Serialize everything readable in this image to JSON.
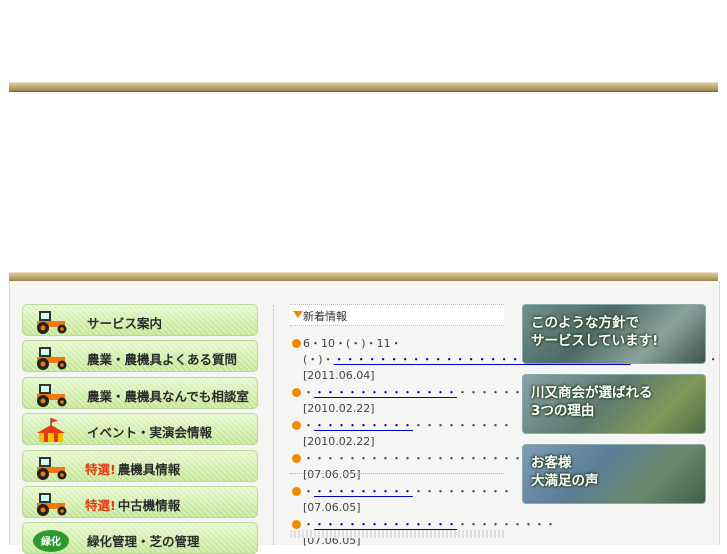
{
  "nav": {
    "items": [
      {
        "label": "サービス案内",
        "prefix": "",
        "icon": "tractor-icon"
      },
      {
        "label": "農業・農機具よくある質問",
        "prefix": "",
        "icon": "tractor-icon"
      },
      {
        "label": "農業・農機具なんでも相談室",
        "prefix": "",
        "icon": "tractor-icon"
      },
      {
        "label": "イベント・実演会情報",
        "prefix": "",
        "icon": "tent-icon"
      },
      {
        "label": "農機具情報",
        "prefix": "特選!",
        "icon": "tractor-icon"
      },
      {
        "label": "中古機情報",
        "prefix": "特選!",
        "icon": "tractor-icon"
      },
      {
        "label": "緑化管理・芝の管理",
        "prefix": "",
        "icon": "greening-badge-icon",
        "badge_text": "緑化"
      }
    ]
  },
  "news": {
    "title": "新着情報",
    "items": [
      {
        "pre": "6・10・(・)・11・(・)・",
        "link": "・・・・・・・・・・・・・・・・・・・・・・・・・・・",
        "post": "・・・・・・・・",
        "date": "[2011.06.04]"
      },
      {
        "pre": "・",
        "link": "・・・・・・・・・・・・・",
        "post": "・・・・・・・・・",
        "date": "[2010.02.22]"
      },
      {
        "pre": "・",
        "link": "・・・・・・・・・",
        "post": "・・・・・・・・・",
        "date": "[2010.02.22]"
      },
      {
        "pre": "・・・・・・・・・・・・・・・・・・・・・・・・",
        "link": "",
        "post": "",
        "date": "[07.06.05]"
      },
      {
        "pre": "・",
        "link": "・・・・・・・・・",
        "post": "・・・・・・・・・",
        "date": "[07.06.05]"
      },
      {
        "pre": "・",
        "link": "・・・・・・・・・・・・・",
        "post": "・・・・・・・・・",
        "date": "[07.06.05]"
      }
    ]
  },
  "banners": [
    {
      "line1": "このような方針で",
      "line2": "サービスしています!"
    },
    {
      "line1": "川又商会が選ばれる",
      "line2": "3つの理由"
    },
    {
      "line1": "お客様",
      "line2": "大満足の声"
    }
  ],
  "colors": {
    "accent_orange": "#f08a00",
    "link_blue": "#0000cc",
    "nav_green": "#cbeb9e",
    "tokusen_red": "#e8380d"
  }
}
